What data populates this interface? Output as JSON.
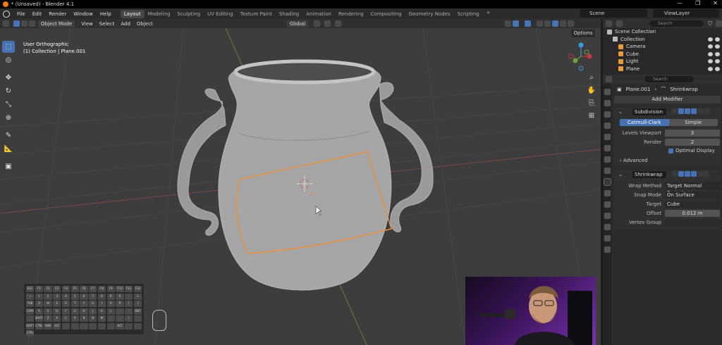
{
  "window": {
    "title": "* (Unsaved) - Blender 4.1",
    "controls": [
      "—",
      "❐",
      "✕"
    ]
  },
  "menu": [
    "File",
    "Edit",
    "Render",
    "Window",
    "Help"
  ],
  "workspaces": [
    "Layout",
    "Modeling",
    "Sculpting",
    "UV Editing",
    "Texture Paint",
    "Shading",
    "Animation",
    "Rendering",
    "Compositing",
    "Geometry Nodes",
    "Scripting"
  ],
  "active_workspace": "Layout",
  "scene": "Scene",
  "view_layer": "ViewLayer",
  "viewport_header": {
    "mode": "Object Mode",
    "menus": [
      "View",
      "Select",
      "Add",
      "Object"
    ],
    "orientation": "Global",
    "options": "Options"
  },
  "viewport": {
    "info_line1": "User Orthographic",
    "info_line2": "(1) Collection | Plane.001",
    "keyboard_keys": [
      "ESC",
      "F1",
      "F2",
      "F3",
      "F4",
      "F5",
      "F6",
      "F7",
      "F8",
      "F9",
      "F10",
      "F11",
      "F12",
      "~",
      "1",
      "2",
      "3",
      "4",
      "5",
      "6",
      "7",
      "8",
      "9",
      "0",
      "-",
      "+",
      "TAB",
      "Q",
      "W",
      "E",
      "R",
      "T",
      "Y",
      "U",
      "I",
      "O",
      "P",
      "[",
      "]",
      "CAPS",
      "A",
      "S",
      "D",
      "F",
      "G",
      "H",
      "J",
      "K",
      "L",
      ";",
      "'",
      "ENT",
      "",
      "SHIFT",
      "Z",
      "X",
      "C",
      "V",
      "B",
      "N",
      "M",
      ",",
      ".",
      "/",
      "",
      "SHIFT",
      "CTRL",
      "WIN",
      "ALT",
      "",
      "",
      "",
      "",
      "",
      "",
      "ALT",
      "",
      "",
      "CTRL"
    ]
  },
  "outliner": {
    "search_placeholder": "Search",
    "rows": [
      {
        "label": "Scene Collection",
        "indent": 0,
        "icon_color": "#bbbbbb"
      },
      {
        "label": "Collection",
        "indent": 1,
        "icon_color": "#bbbbbb"
      },
      {
        "label": "Camera",
        "indent": 2,
        "icon_color": "#e79a3b"
      },
      {
        "label": "Cube",
        "indent": 2,
        "icon_color": "#e79a3b"
      },
      {
        "label": "Light",
        "indent": 2,
        "icon_color": "#e79a3b"
      },
      {
        "label": "Plane",
        "indent": 2,
        "icon_color": "#e79a3b"
      }
    ]
  },
  "properties": {
    "search_placeholder": "Search",
    "object_name": "Plane.001",
    "active_modifier": "Shrinkwrap",
    "add_modifier": "Add Modifier",
    "subdivision": {
      "name": "Subdivision",
      "mode_catmull": "Catmull-Clark",
      "mode_simple": "Simple",
      "levels_viewport_label": "Levels Viewport",
      "levels_viewport": "3",
      "render_label": "Render",
      "render": "2",
      "optimal_display": "Optimal Display",
      "advanced": "Advanced"
    },
    "shrinkwrap": {
      "name": "Shrinkwrap",
      "wrap_method_label": "Wrap Method",
      "wrap_method": "Target Normal Project",
      "snap_mode_label": "Snap Mode",
      "snap_mode": "On Surface",
      "target_label": "Target",
      "target": "Cube",
      "offset_label": "Offset",
      "offset": "0.012 m",
      "vertex_group_label": "Vertex Group"
    }
  },
  "colors": {
    "accent": "#4772b3",
    "selection_outline": "#e8913a",
    "viewport_bg": "#3d3d3d",
    "object_orange": "#e79a3b"
  }
}
